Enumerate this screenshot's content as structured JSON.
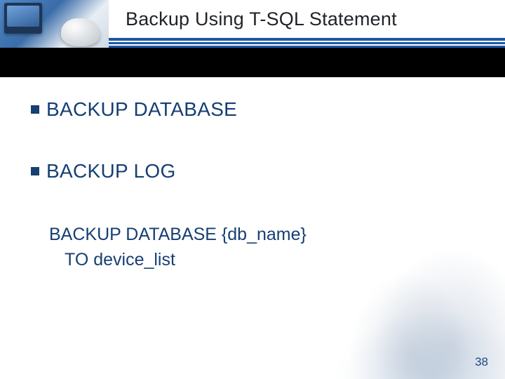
{
  "slide": {
    "title": "Backup Using T-SQL Statement",
    "bullets": [
      "BACKUP DATABASE",
      "BACKUP LOG"
    ],
    "code": {
      "line1": "BACKUP DATABASE {db_name}",
      "line2": "TO device_list"
    },
    "page_number": "38"
  }
}
